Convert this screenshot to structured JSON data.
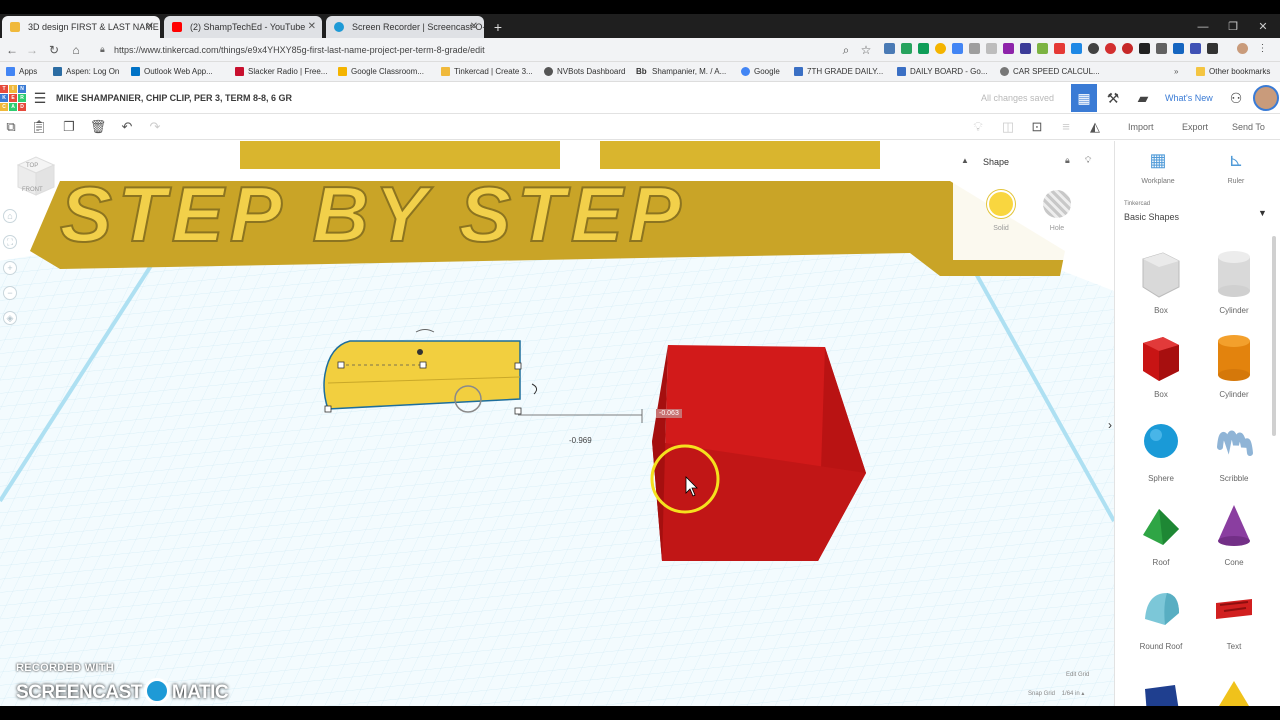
{
  "browser": {
    "tabs": [
      {
        "title": "3D design FIRST & LAST NAME",
        "icon": "tinkercad-favicon",
        "color": "#f0b93b"
      },
      {
        "title": "(2) ShampTechEd - YouTube",
        "icon": "youtube-favicon",
        "color": "#ff0000"
      },
      {
        "title": "Screen Recorder | Screencast-O-M",
        "icon": "screencast-favicon",
        "color": "#1e9ad6"
      }
    ],
    "url": "https://www.tinkercad.com/things/e9x4YHXY85g-first-last-name-project-per-term-8-grade/edit",
    "bookmarks": [
      {
        "label": "Apps",
        "color": "#4285f4"
      },
      {
        "label": "Aspen: Log On",
        "color": "#2b6ca3"
      },
      {
        "label": "Outlook Web App...",
        "color": "#0072c6"
      },
      {
        "label": "Slacker Radio | Free...",
        "color": "#c8102e"
      },
      {
        "label": "Google Classroom...",
        "color": "#f4b400"
      },
      {
        "label": "Tinkercad | Create 3...",
        "color": "#f0b93b"
      },
      {
        "label": "NVBots Dashboard",
        "color": "#555555"
      },
      {
        "label": "Shampanier, M. / A...",
        "color": "#222222"
      },
      {
        "label": "Google",
        "color": "#4285f4"
      },
      {
        "label": "7TH GRADE DAILY...",
        "color": "#3a6fc4"
      },
      {
        "label": "DAILY BOARD - Go...",
        "color": "#3a6fc4"
      },
      {
        "label": "CAR SPEED CALCUL...",
        "color": "#777777"
      }
    ],
    "other_bookmarks": "Other bookmarks",
    "bm_prefix": "Bb"
  },
  "header": {
    "project_title": "MIKE SHAMPANIER, CHIP CLIP, PER 3, TERM 8-8, 6 GR",
    "save_status": "All changes saved",
    "whats_new": "What's New",
    "logo_letters": [
      "TIN",
      "KER",
      "CAD"
    ]
  },
  "toolbar": {
    "import": "Import",
    "export": "Export",
    "send_to": "Send To"
  },
  "viewcube": {
    "top": "TOP",
    "front": "FRONT"
  },
  "workplane_text": "STEP BY STEP",
  "dimensions": {
    "length": "-0.969",
    "offset": "-0.063"
  },
  "inspector": {
    "title": "Shape",
    "solid": "Solid",
    "hole": "Hole",
    "solid_color": "#f9d63f"
  },
  "library": {
    "workplane": "Workplane",
    "ruler": "Ruler",
    "source": "Tinkercad",
    "category": "Basic Shapes",
    "shapes": [
      {
        "label": "Box",
        "kind": "box-hole"
      },
      {
        "label": "Cylinder",
        "kind": "cylinder-hole"
      },
      {
        "label": "Box",
        "kind": "box"
      },
      {
        "label": "Cylinder",
        "kind": "cylinder"
      },
      {
        "label": "Sphere",
        "kind": "sphere"
      },
      {
        "label": "Scribble",
        "kind": "scribble"
      },
      {
        "label": "Roof",
        "kind": "roof"
      },
      {
        "label": "Cone",
        "kind": "cone"
      },
      {
        "label": "Round Roof",
        "kind": "round-roof"
      },
      {
        "label": "Text",
        "kind": "text"
      }
    ]
  },
  "grid": {
    "edit_grid": "Edit Grid",
    "snap_grid": "Snap Grid",
    "snap_value": "1/64 in"
  },
  "watermark": {
    "recorded_with": "RECORDED WITH",
    "brand_left": "SCREENCAST",
    "brand_right": "MATIC"
  }
}
